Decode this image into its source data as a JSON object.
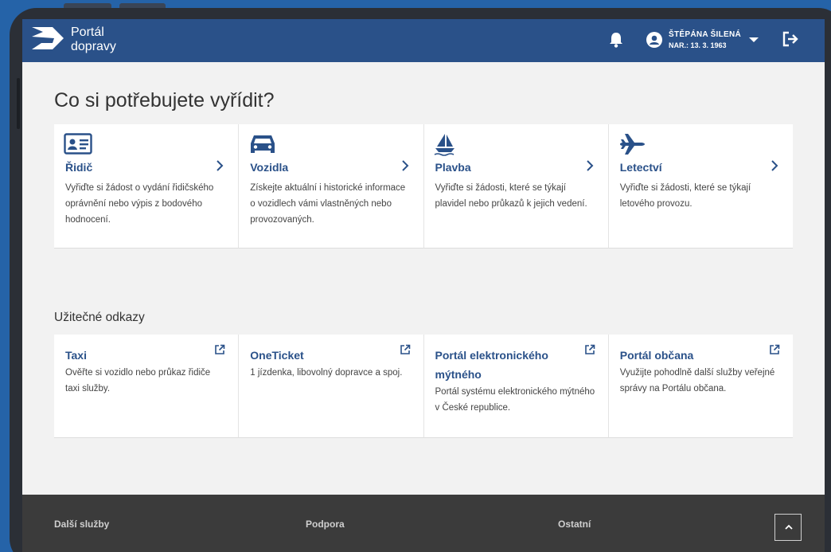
{
  "header": {
    "brand_line1": "Portál",
    "brand_line2": "dopravy",
    "user_name": "ŠTĚPÁNA ŠILENÁ",
    "user_birth": "NAR.: 13. 3. 1963"
  },
  "main": {
    "heading": "Co si potřebujete vyřídit?",
    "services": [
      {
        "title": "Řidič",
        "icon": "id-card-icon",
        "desc": "Vyřiďte si žádost o vydání řidičského oprávnění nebo výpis z bodového hodnocení."
      },
      {
        "title": "Vozidla",
        "icon": "car-icon",
        "desc": "Získejte aktuální i historické informace o vozidlech vámi vlastněných nebo provozovaných."
      },
      {
        "title": "Plavba",
        "icon": "sailboat-icon",
        "desc": "Vyřiďte si žádosti, které se týkají plavidel nebo průkazů k jejich vedení."
      },
      {
        "title": "Letectví",
        "icon": "airplane-icon",
        "desc": "Vyřiďte si žádosti, které se týkají letového provozu."
      }
    ],
    "links_heading": "Užitečné odkazy",
    "links": [
      {
        "title": "Taxi",
        "desc": "Ověřte si vozidlo nebo průkaz řidiče taxi služby."
      },
      {
        "title": "OneTicket",
        "desc": "1 jízdenka, libovolný dopravce a spoj."
      },
      {
        "title": "Portál elektronického mýtného",
        "desc": "Portál systému elektronického mýtného v České republice."
      },
      {
        "title": "Portál občana",
        "desc": "Využijte pohodlně další služby veřejné správy na Portálu občana."
      }
    ]
  },
  "footer": {
    "items": [
      "Další služby",
      "Podpora",
      "Ostatní"
    ]
  },
  "colors": {
    "brand": "#2a5189",
    "footer": "#3b3b3b"
  }
}
